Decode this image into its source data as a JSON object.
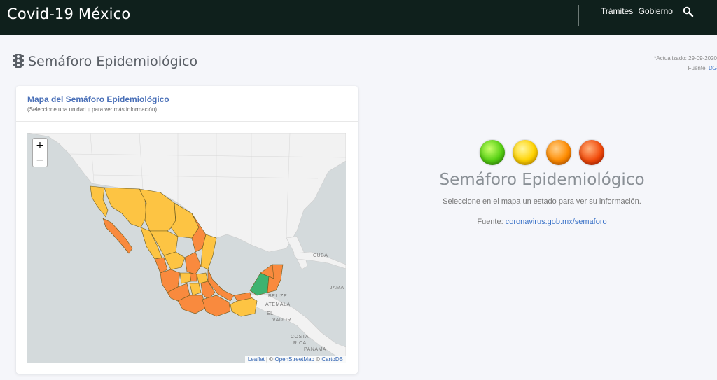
{
  "header": {
    "brand": "Covid-19 México",
    "nav": [
      "Trámites",
      "Gobierno"
    ],
    "search_icon": "search-icon"
  },
  "page": {
    "title": "Semáforo Epidemiológico",
    "title_icon": "traffic-light-icon",
    "updated_label": "*Actualizado: 29-09-2020",
    "source_label": "Fuente:",
    "source_link": "DG"
  },
  "card": {
    "title": "Mapa del Semáforo Epidemiológico",
    "subtitle": "(Seleccione una unidad ↓ para ver más información)"
  },
  "map": {
    "zoom_in": "+",
    "zoom_out": "−",
    "attrib_leaflet": "Leaflet",
    "attrib_sep1": " | © ",
    "attrib_osm": "OpenStreetMap",
    "attrib_sep2": " © ",
    "attrib_carto": "CartoDB",
    "labels": {
      "cuba": "CUBA",
      "jamaica": "JAMA",
      "belize": "BELIZE",
      "guatemala": "ATEMALA",
      "el": "EL",
      "salvador": "VADOR",
      "costa": "COSTA",
      "rica": "RICA",
      "panama": "PANAMA"
    },
    "colors": {
      "green": "#3eb370",
      "yellow": "#fdc443",
      "orange": "#f98a3e",
      "land": "#f2f2f2",
      "water": "#d4dadc"
    }
  },
  "info": {
    "lights": [
      "green",
      "yellow",
      "orange",
      "red"
    ],
    "title": "Semáforo Epidemiológico",
    "text": "Seleccione en el mapa un estado para ver su información.",
    "source_label": "Fuente:",
    "source_link": "coronavirus.gob.mx/semaforo"
  }
}
